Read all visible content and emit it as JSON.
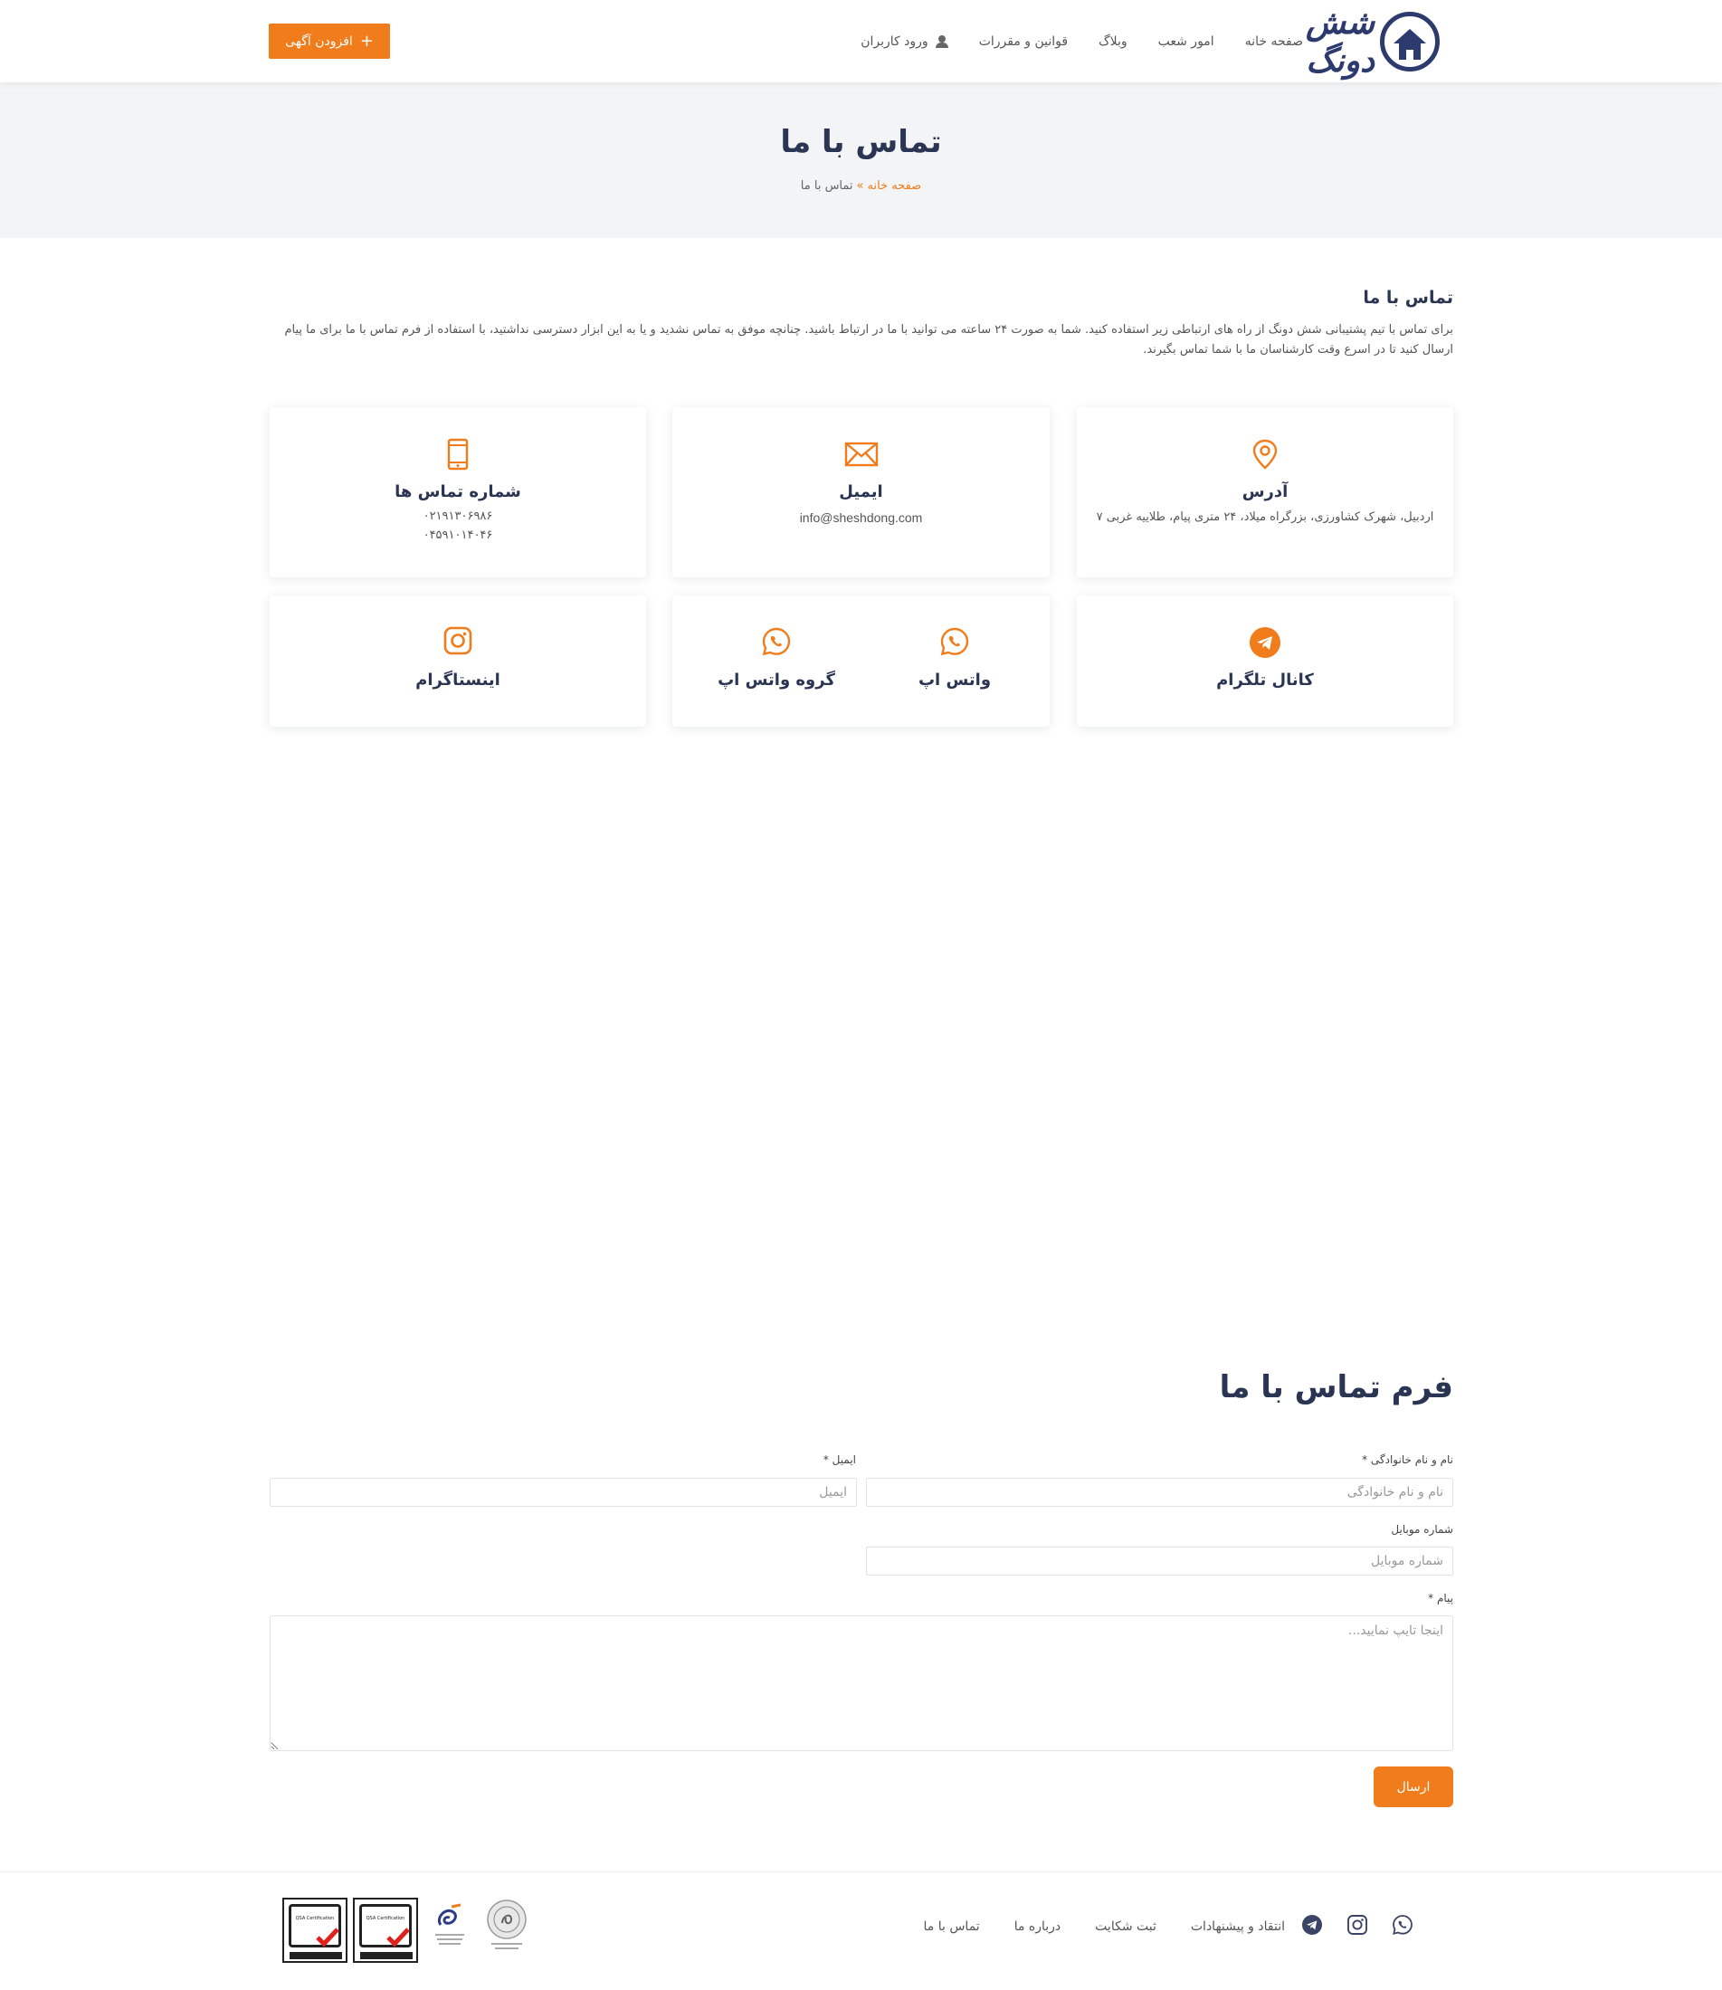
{
  "brand": {
    "logo_text": "شش دونگ",
    "accent": "#f07c1b",
    "navy": "#2a3553"
  },
  "header": {
    "nav": [
      "صفحه خانه",
      "امور شعب",
      "وبلاگ",
      "قوانین و مقررات",
      "ورود کاربران"
    ],
    "add_button": "افزودن آگهی"
  },
  "banner": {
    "title": "تماس با ما",
    "breadcrumb_home": "صفحه خانه",
    "breadcrumb_sep": "»",
    "breadcrumb_current": "تماس با ما"
  },
  "intro": {
    "title": "تماس با ما",
    "text": "برای تماس با تیم پشتیبانی شش دونگ از راه های ارتباطی زیر استفاده کنید. شما به صورت ۲۴ ساعته می توانید با ما در ارتباط باشید. چنانچه موفق به تماس نشدید و یا به این ابزار دسترسی نداشتید، با استفاده از فرم تماس با ما برای ما پیام ارسال کنید تا در اسرع وقت کارشناسان ما با شما تماس بگیرند."
  },
  "cards": {
    "address": {
      "title": "آدرس",
      "value": "اردبیل، شهرک کشاورزی، بزرگراه میلاد، ۲۴ متری پیام، طلاییه غربی ۷",
      "icon": "location-pin-icon"
    },
    "email": {
      "title": "ایمیل",
      "value": "info@sheshdong.com",
      "icon": "envelope-icon"
    },
    "phone": {
      "title": "شماره تماس ها",
      "value1": "۰۲۱۹۱۳۰۶۹۸۶",
      "value2": "۰۴۵۹۱۰۱۴۰۴۶",
      "icon": "mobile-phone-icon"
    },
    "telegram": {
      "title": "کانال تلگرام",
      "icon": "telegram-icon"
    },
    "whatsapp": {
      "title": "واتس اپ",
      "icon": "whatsapp-icon"
    },
    "whatsapp_group": {
      "title": "گروه واتس اپ",
      "icon": "whatsapp-icon"
    },
    "instagram": {
      "title": "اینستاگرام",
      "icon": "instagram-icon"
    }
  },
  "form": {
    "title": "فرم تماس با ما",
    "name_label": "نام و نام خانوادگی *",
    "name_placeholder": "نام و نام خانوادگی",
    "email_label": "ایمیل *",
    "email_placeholder": "ایمیل",
    "mobile_label": "شماره موبایل",
    "mobile_placeholder": "شماره موبایل",
    "message_label": "پیام *",
    "message_placeholder": "اینجا تایپ نمایید...",
    "submit": "ارسال"
  },
  "footer": {
    "links": [
      "انتقاد و پیشنهادات",
      "ثبت شکایت",
      "درباره ما",
      "تماس با ما"
    ],
    "badge_text": "QSA Certification"
  }
}
